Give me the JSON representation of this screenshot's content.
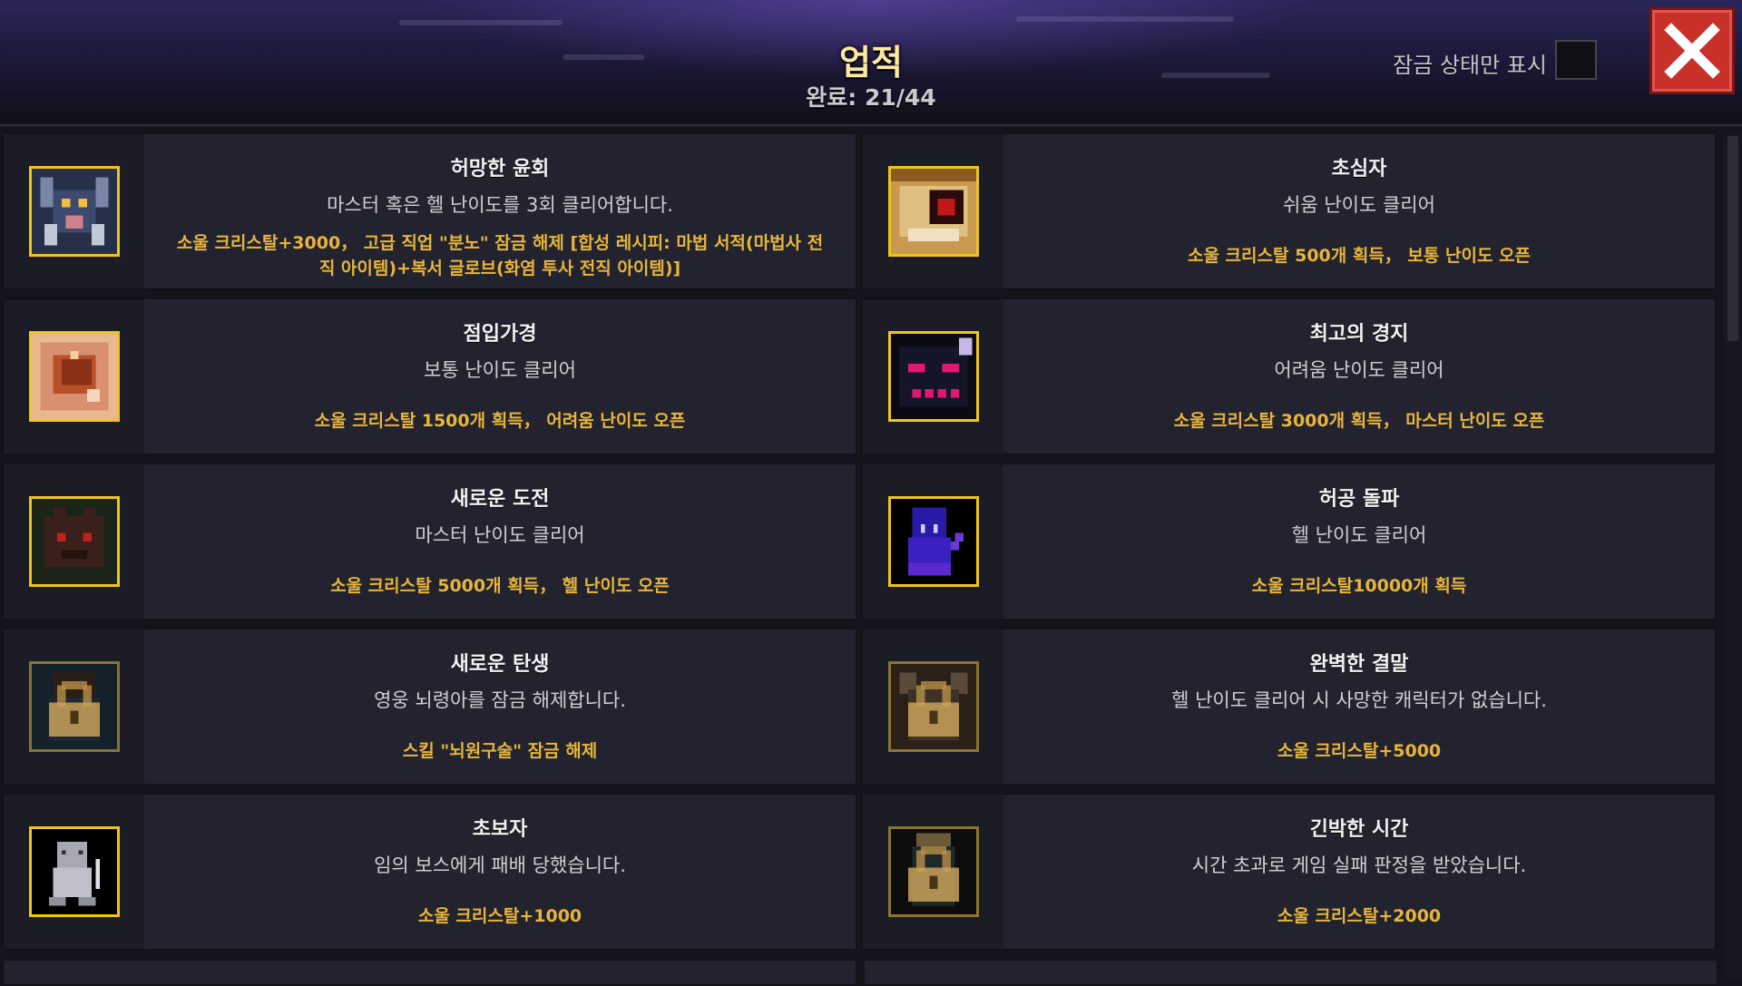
{
  "header": {
    "title": "업적",
    "progress": "완료: 21/44",
    "filter_label": "잠금 상태만 표시"
  },
  "achievements": [
    {
      "name": "허망한 윤회",
      "desc": "마스터 혹은 헬 난이도를 3회 클리어합니다.",
      "reward": "소울 크리스탈+3000， 고급 직업 \"분노\" 잠금 해제 [합성 레시피: 마법 서적(마법사 전직 아이템)+복서 글로브(화염 투사 전직 아이템)]",
      "icon": "horned-demon-icon",
      "locked": false
    },
    {
      "name": "초심자",
      "desc": "쉬움 난이도 클리어",
      "reward": "소울 크리스탈 500개 획득， 보통 난이도 오픈",
      "icon": "red-eye-beast-icon",
      "locked": false
    },
    {
      "name": "점입가경",
      "desc": "보통 난이도 클리어",
      "reward": "소울 크리스탈 1500개 획득， 어려움 난이도 오픈",
      "icon": "flame-claw-icon",
      "locked": false
    },
    {
      "name": "최고의 경지",
      "desc": "어려움 난이도 클리어",
      "reward": "소울 크리스탈 3000개 획득， 마스터 난이도 오픈",
      "icon": "shadow-demon-icon",
      "locked": false
    },
    {
      "name": "새로운 도전",
      "desc": "마스터 난이도 클리어",
      "reward": "소울 크리스탈 5000개 획득， 헬 난이도 오픈",
      "icon": "dark-beast-icon",
      "locked": false
    },
    {
      "name": "허공 돌파",
      "desc": "헬 난이도 클리어",
      "reward": "소울 크리스탈10000개 획득",
      "icon": "void-spirit-icon",
      "locked": false
    },
    {
      "name": "새로운 탄생",
      "desc": "영웅 뇌령아를 잠금 해제합니다.",
      "reward": "스킬 \"뇌원구술\" 잠금 해제",
      "icon": "padlock-icon",
      "locked": true
    },
    {
      "name": "완벽한 결말",
      "desc": "헬 난이도 클리어 시 사망한 캐릭터가 없습니다.",
      "reward": "소울 크리스탈+5000",
      "icon": "padlock-icon",
      "locked": true
    },
    {
      "name": "초보자",
      "desc": "임의 보스에게 패배 당했습니다.",
      "reward": "소울 크리스탈+1000",
      "icon": "grey-knight-icon",
      "locked": false
    },
    {
      "name": "긴박한 시간",
      "desc": "시간 초과로 게임 실패 판정을 받았습니다.",
      "reward": "소울 크리스탈+2000",
      "icon": "padlock-icon",
      "locked": true
    }
  ],
  "colors": {
    "title": "#ffe9a0",
    "reward": "#e7b53b",
    "icon_border": "#f0c51a",
    "close_button": "#c9302a"
  }
}
